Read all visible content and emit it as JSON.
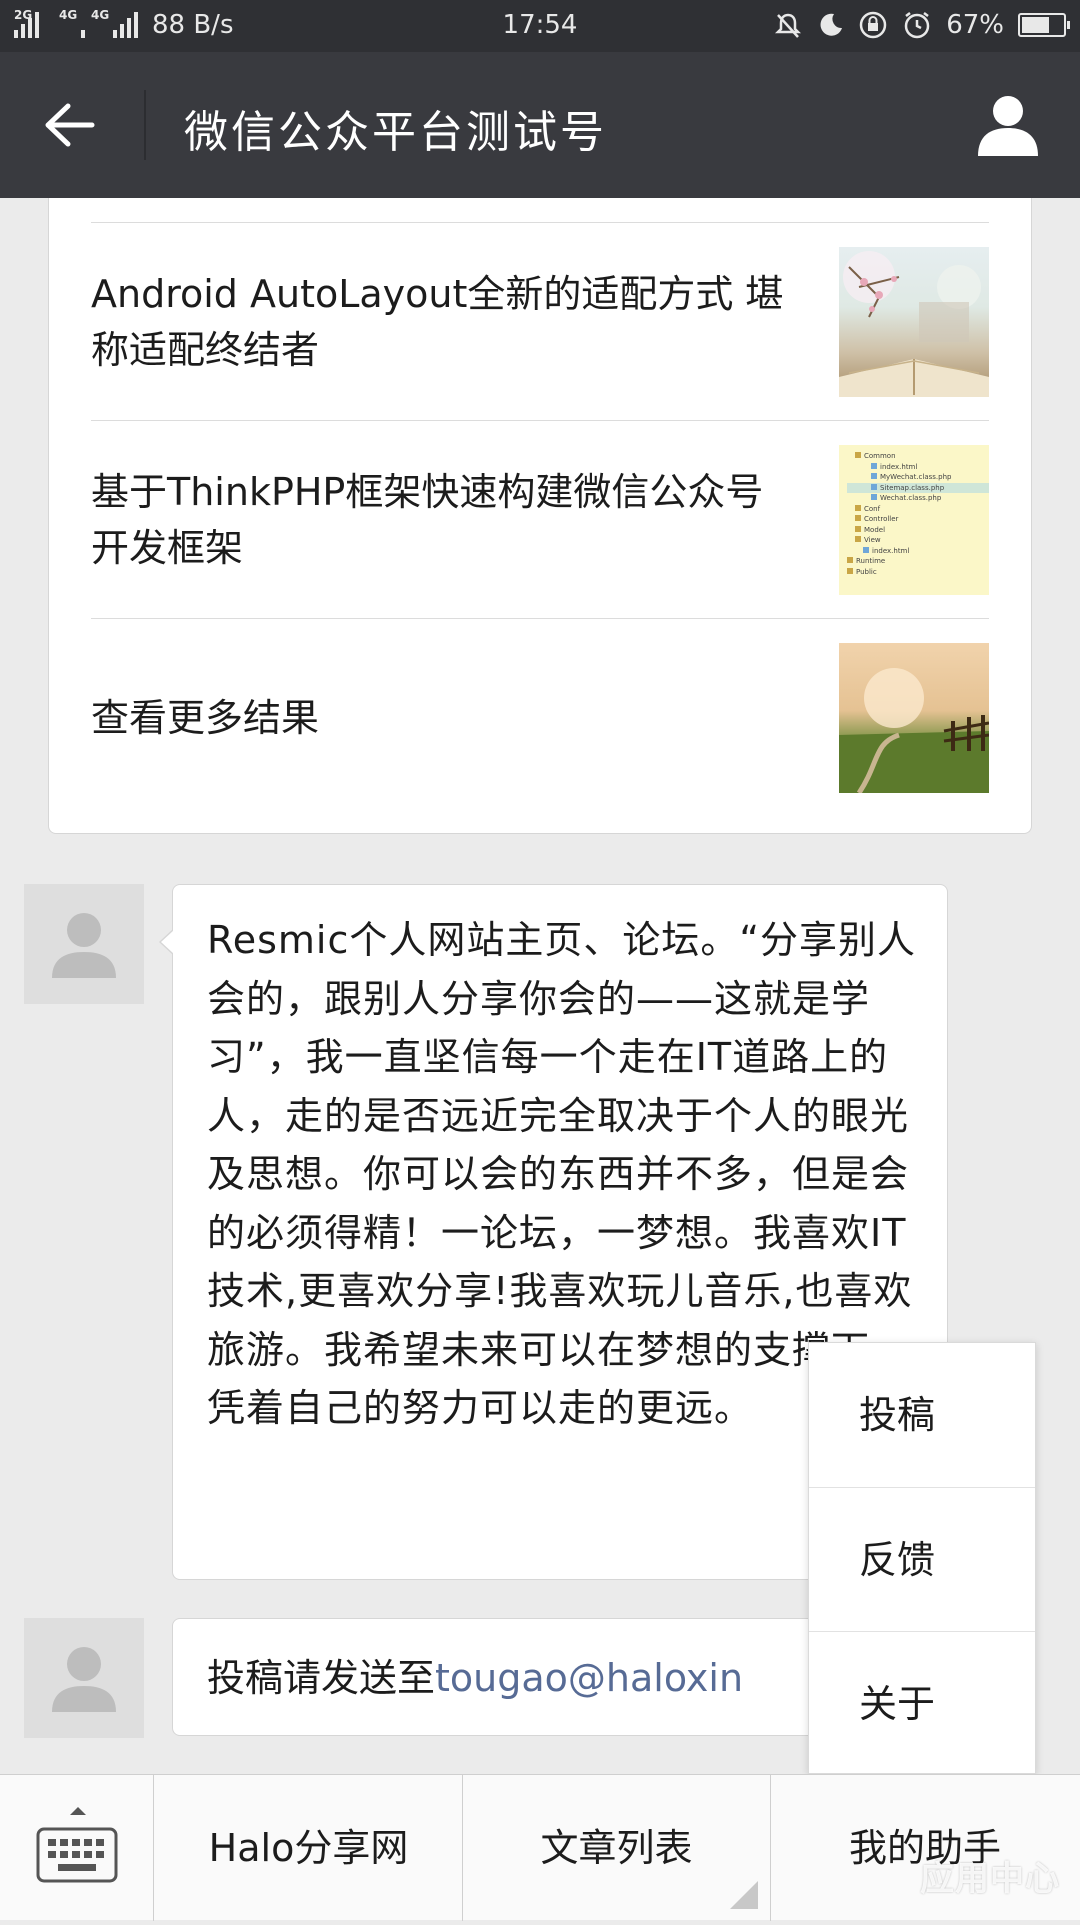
{
  "status_bar": {
    "network_1": "2G",
    "network_2": "4G",
    "network_3": "4G",
    "speed": "88 B/s",
    "time": "17:54",
    "battery": "67%",
    "battery_level": 0.67,
    "icons": [
      "mute-icon",
      "moon-icon",
      "rotation-lock-icon",
      "alarm-icon"
    ]
  },
  "title_bar": {
    "title": "微信公众平台测试号"
  },
  "articles": [
    {
      "title": "Android AutoLayout全新的适配方式 堪称适配终结者"
    },
    {
      "title": "基于ThinkPHP框架快速构建微信公众号开发框架"
    },
    {
      "title": "查看更多结果"
    }
  ],
  "thumb_tree": [
    "Common",
    "index.html",
    "MyWechat.class.php",
    "Sitemap.class.php",
    "Wechat.class.php",
    "Conf",
    "Controller",
    "Model",
    "View",
    "index.html",
    "Runtime",
    "Public"
  ],
  "messages": [
    {
      "text": "Resmic个人网站主页、论坛。“分享别人会的，跟别人分享你会的——这就是学习”，我一直坚信每一个走在IT道路上的人，走的是否远近完全取决于个人的眼光及思想。你可以会的东西并不多，但是会的必须得精！一论坛，一梦想。我喜欢IT技术,更喜欢分享!我喜欢玩儿音乐,也喜欢旅游。我希望未来可以在梦想的支撑下，凭着自己的努力可以走的更远。"
    },
    {
      "prefix": "投稿请发送至",
      "link": "tougao@haloxin"
    }
  ],
  "popup_menu": [
    "投稿",
    "反馈",
    "关于"
  ],
  "bottom_menu": [
    "Halo分享网",
    "文章列表",
    "我的助手"
  ],
  "watermark": "应用中心"
}
